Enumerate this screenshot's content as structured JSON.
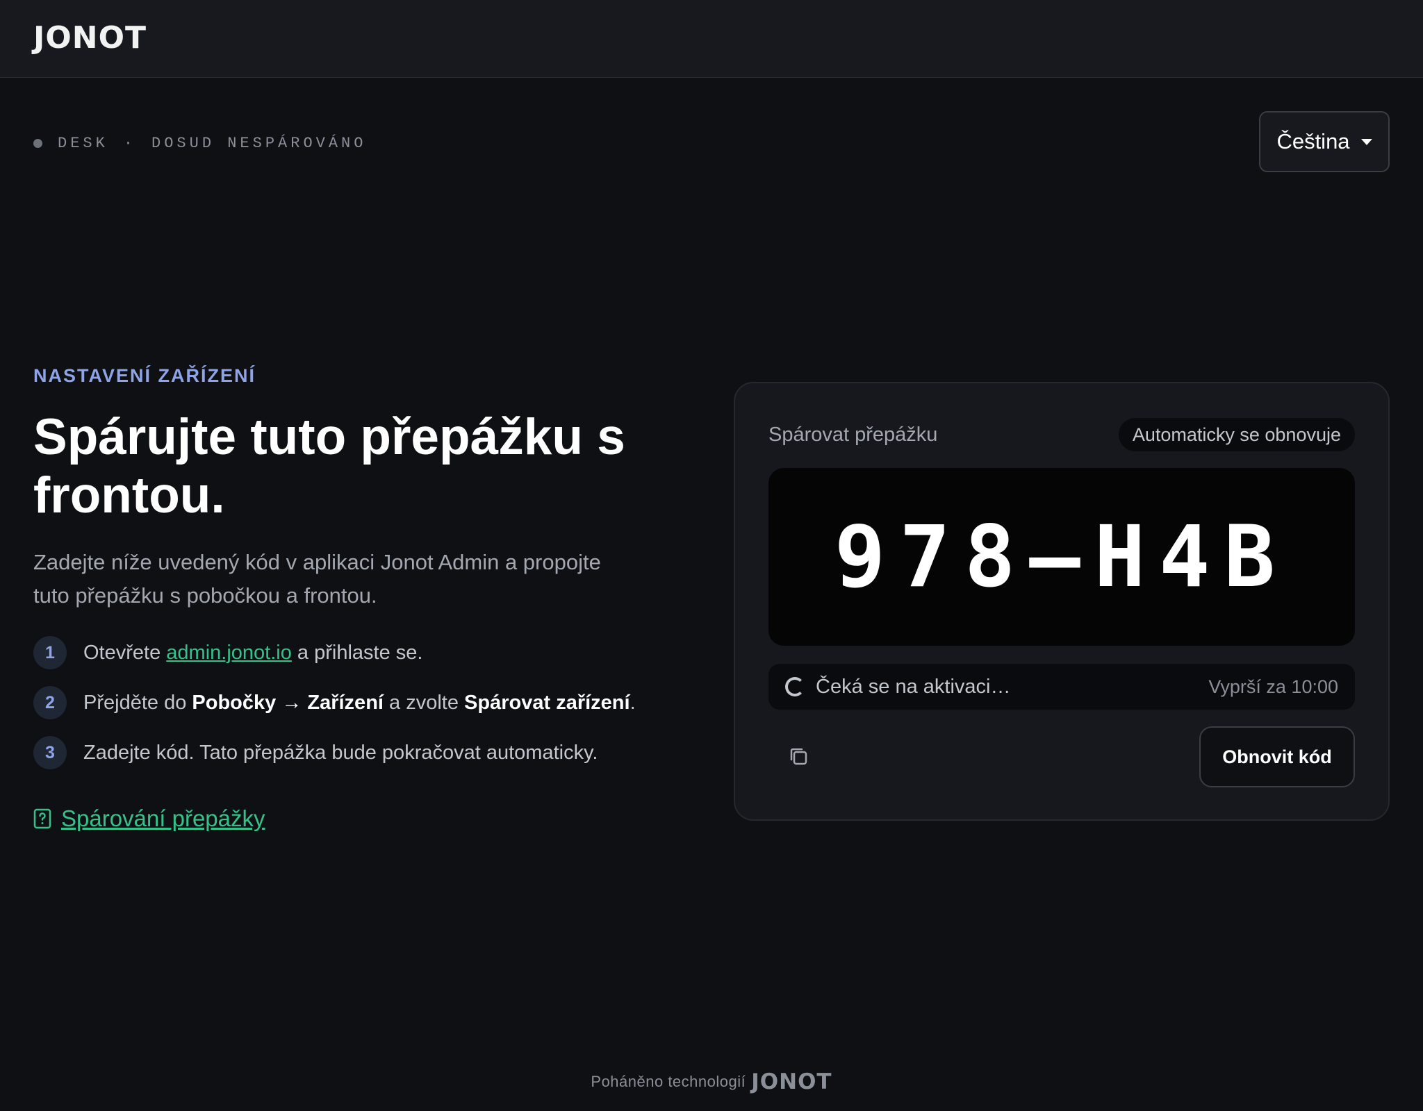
{
  "header": {
    "logo_text": "JONOT"
  },
  "status": {
    "device": "DESK",
    "separator": "·",
    "pair_state": "DOSUD NESPÁROVÁNO"
  },
  "language": {
    "selected": "Čeština",
    "icon": "chevron-down-icon"
  },
  "intro": {
    "eyebrow": "NASTAVENÍ ZAŘÍZENÍ",
    "headline": "Spárujte tuto přepážku s frontou.",
    "subtext": "Zadejte níže uvedený kód v aplikaci Jonot Admin a propojte tuto přepážku s pobočkou a frontou."
  },
  "steps": {
    "s1": {
      "num": "1",
      "pre": "Otevřete ",
      "link": "admin.jonot.io",
      "post": " a přihlaste se."
    },
    "s2": {
      "num": "2",
      "pre": "Přejděte do ",
      "bold1": "Pobočky → Zařízení",
      "mid": " a zvolte ",
      "bold2": "Spárovat zařízení",
      "post": "."
    },
    "s3": {
      "num": "3",
      "text": "Zadejte kód. Tato přepážka bude pokračovat automaticky."
    }
  },
  "help": {
    "label": "Spárování přepážky",
    "icon": "help-document-icon"
  },
  "card": {
    "title": "Spárovat přepážku",
    "badge": "Automaticky se obnovuje",
    "code": "978–H4B",
    "waiting": "Čeká se na aktivaci…",
    "expiry": "Vyprší za 10:00",
    "copy_icon": "copy-icon",
    "refresh_label": "Obnovit kód"
  },
  "footer": {
    "powered_by": "Poháněno technologií",
    "logo_text": "JONOT"
  },
  "colors": {
    "accent_blue": "#8fa4e6",
    "link_green": "#35c28a",
    "background": "#0e1014"
  }
}
